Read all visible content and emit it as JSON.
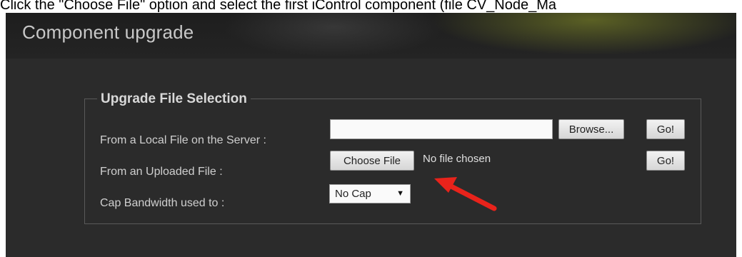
{
  "instruction": "Click the \"Choose File\" option and select the first iControl component (file CV_Node_Ma",
  "header": {
    "title": "Component upgrade"
  },
  "fieldset": {
    "legend": "Upgrade File Selection",
    "rows": [
      {
        "label": "From a Local File on the Server :",
        "browse_label": "Browse...",
        "go_label": "Go!"
      },
      {
        "label": "From an Uploaded File :",
        "choose_label": "Choose File",
        "status": "No file chosen",
        "go_label": "Go!"
      },
      {
        "label": "Cap Bandwidth used to :",
        "select_value": "No Cap"
      }
    ]
  },
  "colors": {
    "annotation_arrow": "#e8231b",
    "panel_bg": "#2b2b2b"
  },
  "icons": {
    "select_caret": "caret-down-icon",
    "annotation": "red-arrow-icon"
  }
}
